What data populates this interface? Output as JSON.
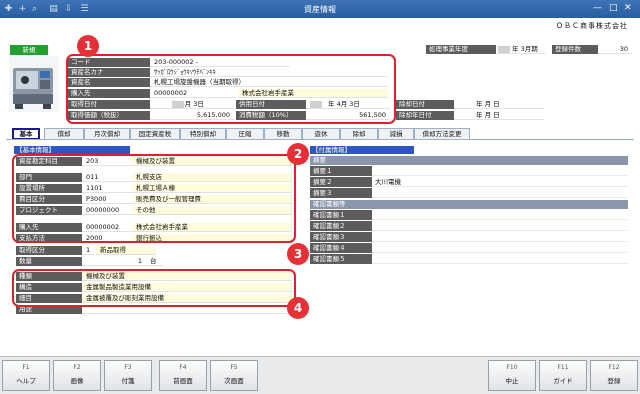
{
  "window": {
    "title": "資産情報",
    "company": "ＯＢＣ商事株式会社"
  },
  "status_badge": "新規",
  "header": {
    "fields": [
      {
        "label": "コード",
        "value": "203-000002 -"
      },
      {
        "label": "資産名カナ",
        "value": "ｻｯｶﾞﾛｳｼﾞｮｳｷｿｳﾁﾊﾞﾝｷｷ"
      },
      {
        "label": "資産名",
        "value": "札幌工場旋盤機器（当期取得）"
      },
      {
        "label": "購入先",
        "value": "00000002",
        "value2": "株式会社岩手産業"
      },
      {
        "label": "取得日付",
        "value": "年  4月  3日",
        "label2": "供用日付",
        "value2": "年  4月  3日"
      },
      {
        "label": "取得価額（税抜）",
        "value": "5,615,000",
        "label2": "消費税額（10%）",
        "value2": "561,500"
      }
    ],
    "side_fields": [
      {
        "label": "除却日付",
        "value": "年    月    日"
      },
      {
        "label": "除却年日付",
        "value": "年    月    日"
      }
    ]
  },
  "fiscal": {
    "label": "処理事業年度",
    "value": "年  3月期"
  },
  "registered": {
    "label": "登録件数",
    "value": "30"
  },
  "tabs": [
    "基本",
    "償却",
    "月次償却",
    "固定資産税",
    "特別償却",
    "圧縮",
    "移動",
    "遊休",
    "除却",
    "減損",
    "償却方法変更"
  ],
  "basic": {
    "section_title": "【基本情報】",
    "category": {
      "label": "資産勘定科目",
      "code": "203",
      "name": "機械及び装置"
    },
    "org": [
      {
        "label": "部門",
        "code": "011",
        "name": "札幌支店"
      },
      {
        "label": "設置場所",
        "code": "1101",
        "name": "札幌工場Ａ棟"
      },
      {
        "label": "費目区分",
        "code": "P3000",
        "name": "販売費及び一般管理費"
      },
      {
        "label": "プロジェクト",
        "code": "00000000",
        "name": "その他"
      }
    ],
    "vendor": [
      {
        "label": "購入先",
        "code": "00000002",
        "name": "株式会社岩手産業"
      },
      {
        "label": "支払方法",
        "code": "2000",
        "name": "銀行振込"
      }
    ],
    "acquisition": {
      "label": "取得区分",
      "code": "1",
      "name": "新品取得"
    },
    "quantity": {
      "label": "数量",
      "value": "1",
      "unit": "台"
    },
    "structure": [
      {
        "label": "種類",
        "value": "機械及び装置"
      },
      {
        "label": "構造",
        "value": "金属製品製造業用設備"
      },
      {
        "label": "細目",
        "value": "金属被覆及び彫刻業用設備"
      },
      {
        "label": "用途",
        "value": ""
      }
    ]
  },
  "attached": {
    "section_title": "【付属情報】",
    "summary_head": "摘要",
    "summary": [
      {
        "label": "摘要１",
        "value": ""
      },
      {
        "label": "摘要２",
        "value": "大川電機"
      },
      {
        "label": "摘要３",
        "value": ""
      }
    ],
    "docs_head": "確認書類等",
    "docs": [
      "確認書類１",
      "確認書類２",
      "確認書類３",
      "確認書類４",
      "確認書類５"
    ]
  },
  "fkeys": [
    {
      "key": "F1",
      "label": "ヘルプ"
    },
    {
      "key": "F2",
      "label": "画像"
    },
    {
      "key": "F3",
      "label": "付箋"
    },
    {
      "key": "F4",
      "label": "前画面"
    },
    {
      "key": "F5",
      "label": "次画面"
    },
    {
      "key": "F10",
      "label": "中止"
    },
    {
      "key": "F11",
      "label": "ガイド"
    },
    {
      "key": "F12",
      "label": "登録"
    }
  ],
  "callouts": [
    "1",
    "2",
    "3",
    "4"
  ],
  "colors": {
    "titlebar": "#285d9e",
    "section": "#2f55c4",
    "label_bg": "#5c5c5c",
    "callout": "#e0202b",
    "badge": "#21a02e"
  }
}
